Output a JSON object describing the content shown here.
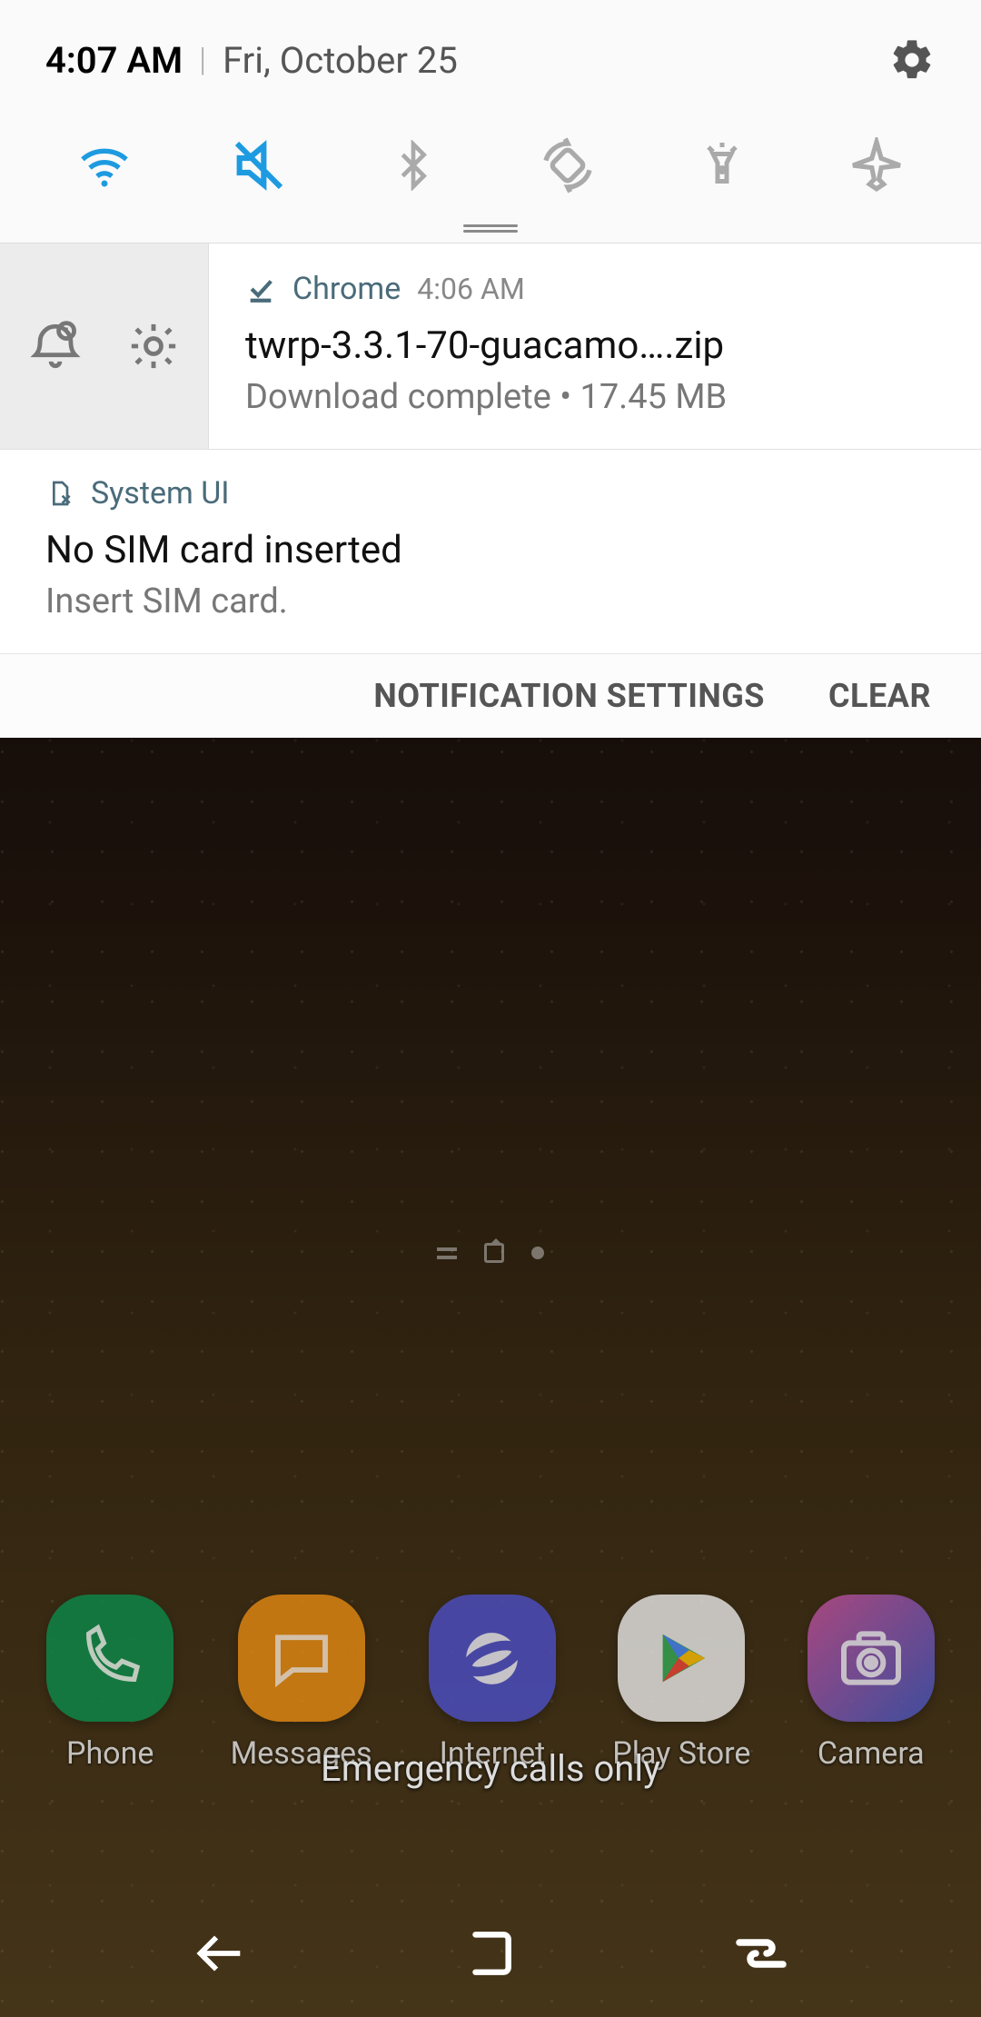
{
  "status": {
    "time": "4:07 AM",
    "date": "Fri, October 25"
  },
  "quick_settings": {
    "wifi": {
      "name": "wifi-icon",
      "active": true
    },
    "mute": {
      "name": "mute-icon",
      "active": true
    },
    "bluetooth": {
      "name": "bluetooth-icon",
      "active": false
    },
    "rotate": {
      "name": "auto-rotate-icon",
      "active": false
    },
    "flashlight": {
      "name": "flashlight-icon",
      "active": false
    },
    "airplane": {
      "name": "airplane-icon",
      "active": false
    }
  },
  "notifications": [
    {
      "icon": "download-done-icon",
      "app": "Chrome",
      "time": "4:06 AM",
      "title": "twrp-3.3.1-70-guacamo….zip",
      "subtitle": "Download complete • 17.45 MB",
      "side_actions": [
        "snooze-icon",
        "gear-icon"
      ]
    },
    {
      "icon": "sim-missing-icon",
      "app": "System UI",
      "title": "No SIM card inserted",
      "subtitle": "Insert SIM card."
    }
  ],
  "footer": {
    "settings_label": "NOTIFICATION SETTINGS",
    "clear_label": "CLEAR"
  },
  "emergency_text": "Emergency calls only",
  "dock": [
    {
      "label": "Phone",
      "icon": "phone-app-icon",
      "color": "#0b8a4a"
    },
    {
      "label": "Messages",
      "icon": "messages-app-icon",
      "color": "#e58a12"
    },
    {
      "label": "Internet",
      "icon": "internet-app-icon",
      "color": "#4b4fc7"
    },
    {
      "label": "Play Store",
      "icon": "playstore-app-icon",
      "color": "#e9e9e9"
    },
    {
      "label": "Camera",
      "icon": "camera-app-icon",
      "color": "#5a4fb8"
    }
  ],
  "colors": {
    "accent_blue": "#1e9be0",
    "inactive_grey": "#aaaaaa",
    "app_header_teal": "#4a6b7a"
  }
}
